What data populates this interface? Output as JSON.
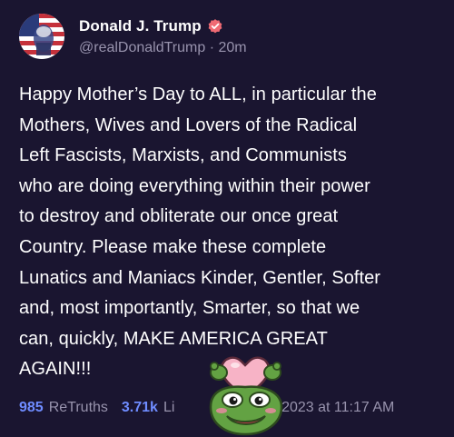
{
  "post": {
    "author": {
      "display_name": "Donald J. Trump",
      "handle": "@realDonaldTrump",
      "separator": "·",
      "relative_time": "20m",
      "verified": true,
      "avatar_icon": "avatar-american-flag"
    },
    "body": "Happy Mother’s Day to ALL, in particular the\nMothers, Wives and Lovers of the Radical\nLeft Fascists, Marxists, and Communists\nwho are doing everything within their power\nto destroy and obliterate our once great\nCountry. Please make these complete\nLunatics and Maniacs Kinder, Gentler, Softer\nand, most importantly, Smarter, so that we\ncan, quickly, MAKE AMERICA GREAT\nAGAIN!!!",
    "stats": {
      "retruths_count": "985",
      "retruths_label": "ReTruths",
      "likes_count": "3.71k",
      "likes_label_partial": "Li",
      "timestamp_partial": "14, 2023 at 11:17 AM"
    }
  },
  "overlay": {
    "sticker_icon": "pepe-frog-heart-sticker"
  },
  "colors": {
    "background": "#1a1530",
    "text_primary": "#ffffff",
    "text_secondary": "#9893ad",
    "accent_blue": "#6f8cff",
    "verified_badge": "#ef6a73",
    "heart_pink": "#f7b3c6",
    "frog_green": "#63a243"
  }
}
